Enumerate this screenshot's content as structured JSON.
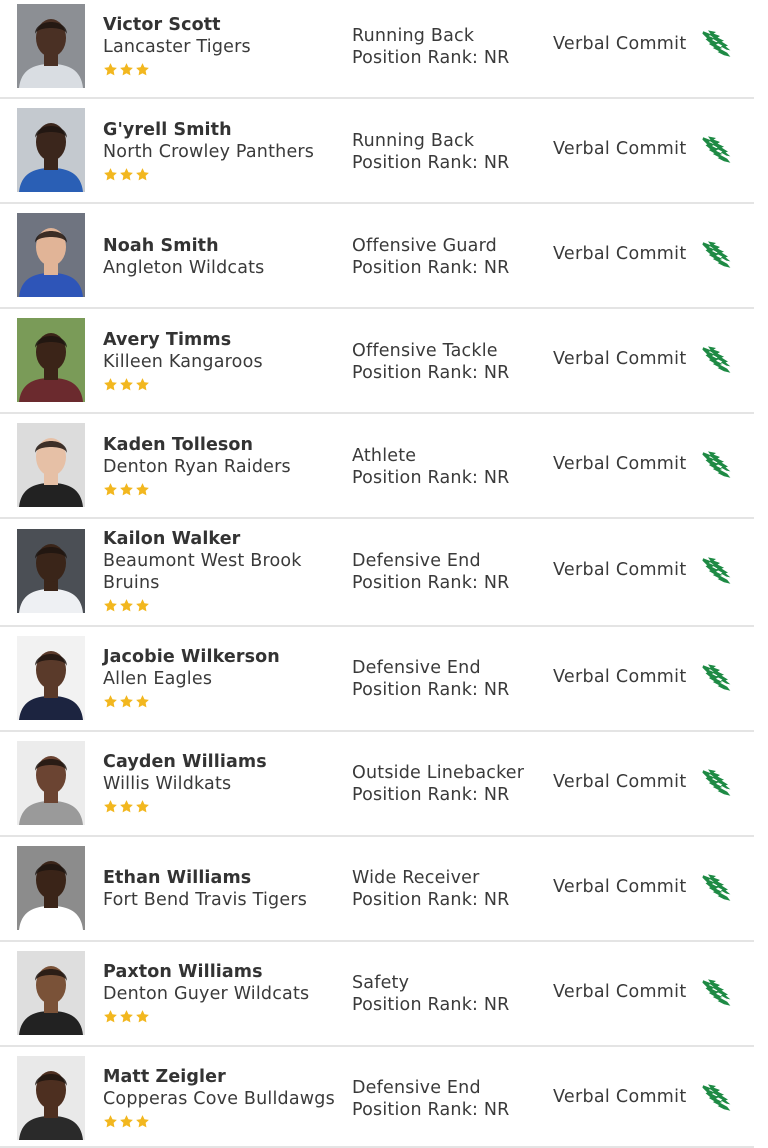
{
  "colors": {
    "star": "#f2b71f",
    "eagle": "#1e8a44",
    "divider": "#e4e4e4",
    "name_text": "#333333"
  },
  "icons": {
    "rating": "star-icon",
    "team_logo": "mean-green-eagle-icon"
  },
  "players": [
    {
      "name": "Victor Scott",
      "school": "Lancaster Tigers",
      "position": "Running Back",
      "rank": "Position Rank: NR",
      "status": "Verbal Commit",
      "stars": 3,
      "skin": "#4a3024",
      "jersey": "#d9dde2",
      "bg": "#8c8f94"
    },
    {
      "name": "G'yrell Smith",
      "school": "North Crowley Panthers",
      "position": "Running Back",
      "rank": "Position Rank: NR",
      "status": "Verbal Commit",
      "stars": 3,
      "skin": "#3b261c",
      "jersey": "#2a5fb5",
      "bg": "#c4c9cf"
    },
    {
      "name": "Noah Smith",
      "school": "Angleton Wildcats",
      "position": "Offensive Guard",
      "rank": "Position Rank: NR",
      "status": "Verbal Commit",
      "stars": 0,
      "skin": "#e1b497",
      "jersey": "#2e55b8",
      "bg": "#6f7480"
    },
    {
      "name": "Avery Timms",
      "school": "Killeen Kangaroos",
      "position": "Offensive Tackle",
      "rank": "Position Rank: NR",
      "status": "Verbal Commit",
      "stars": 3,
      "skin": "#3b2418",
      "jersey": "#6b2a2e",
      "bg": "#7a9b58"
    },
    {
      "name": "Kaden Tolleson",
      "school": "Denton Ryan Raiders",
      "position": "Athlete",
      "rank": "Position Rank: NR",
      "status": "Verbal Commit",
      "stars": 3,
      "skin": "#e6c0a6",
      "jersey": "#222222",
      "bg": "#dcdcdc"
    },
    {
      "name": "Kailon Walker",
      "school": "Beaumont West Brook Bruins",
      "position": "Defensive End",
      "rank": "Position Rank: NR",
      "status": "Verbal Commit",
      "stars": 3,
      "skin": "#3a2519",
      "jersey": "#eef0f3",
      "bg": "#4b4f55"
    },
    {
      "name": "Jacobie Wilkerson",
      "school": "Allen Eagles",
      "position": "Defensive End",
      "rank": "Position Rank: NR",
      "status": "Verbal Commit",
      "stars": 3,
      "skin": "#5a3a2a",
      "jersey": "#1c2440",
      "bg": "#f2f2f2"
    },
    {
      "name": "Cayden Williams",
      "school": "Willis Wildkats",
      "position": "Outside Linebacker",
      "rank": "Position Rank: NR",
      "status": "Verbal Commit",
      "stars": 3,
      "skin": "#6b4432",
      "jersey": "#9a9a9a",
      "bg": "#ececec"
    },
    {
      "name": "Ethan Williams",
      "school": "Fort Bend Travis Tigers",
      "position": "Wide Receiver",
      "rank": "Position Rank: NR",
      "status": "Verbal Commit",
      "stars": 0,
      "skin": "#3a2418",
      "jersey": "#ffffff",
      "bg": "#8c8c8c"
    },
    {
      "name": "Paxton Williams",
      "school": "Denton Guyer Wildcats",
      "position": "Safety",
      "rank": "Position Rank: NR",
      "status": "Verbal Commit",
      "stars": 3,
      "skin": "#7a5238",
      "jersey": "#222222",
      "bg": "#dedede"
    },
    {
      "name": "Matt Zeigler",
      "school": "Copperas Cove Bulldawgs",
      "position": "Defensive End",
      "rank": "Position Rank: NR",
      "status": "Verbal Commit",
      "stars": 3,
      "skin": "#4d2f20",
      "jersey": "#2a2a2a",
      "bg": "#e9e9e9"
    }
  ]
}
